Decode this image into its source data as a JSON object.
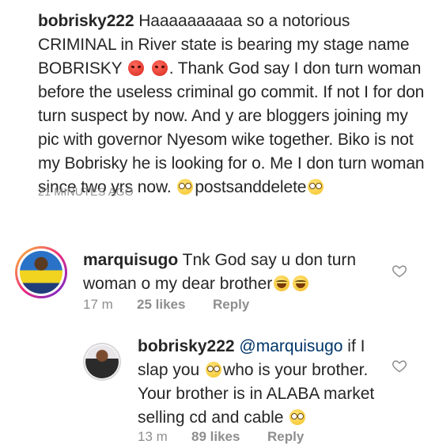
{
  "post": {
    "username": "bobrisky222",
    "text_1": " Haaaaaaaaaa so a notorious CRIMINAL in River state is bearing my stage name BOBRISKY ",
    "text_2": ". Thank God say I don turn woman before the useless criminal go commit. If not I for don turn suspect by now. And y are bloggers joining my pic with governor Nyesom wike together. Biko is not my Bobrisky he is looking for o. Me I don turn woman since two yrs now. ",
    "text_3": "postsanddelete",
    "emoji_1": "angry-face-icon",
    "emoji_2": "angry-face-icon",
    "emoji_3": "face-with-rolling-eyes-icon",
    "emoji_4": "face-with-rolling-eyes-icon",
    "timestamp": "21 MINUTES AGO"
  },
  "comments": [
    {
      "username": "marquisugo",
      "text": " Tnk God say u don turn woman o my dear brother",
      "emojis": [
        "grinning-squinting-face-icon",
        "grinning-squinting-face-icon"
      ],
      "time": "17 m",
      "likes": "25 likes",
      "reply": "Reply"
    },
    {
      "username": "bobrisky222",
      "mention": "@marquisugo",
      "text_1": " if I slap you ",
      "text_2": "who is your brother. Your brother is in ALABA market selling cd and cable ",
      "emojis": [
        "face-with-rolling-eyes-icon",
        "face-with-rolling-eyes-icon"
      ],
      "time": "13 m",
      "likes": "89 likes",
      "reply": "Reply"
    }
  ],
  "colors": {
    "text": "#262626",
    "muted": "#8e8e8e",
    "mention": "#003569"
  }
}
